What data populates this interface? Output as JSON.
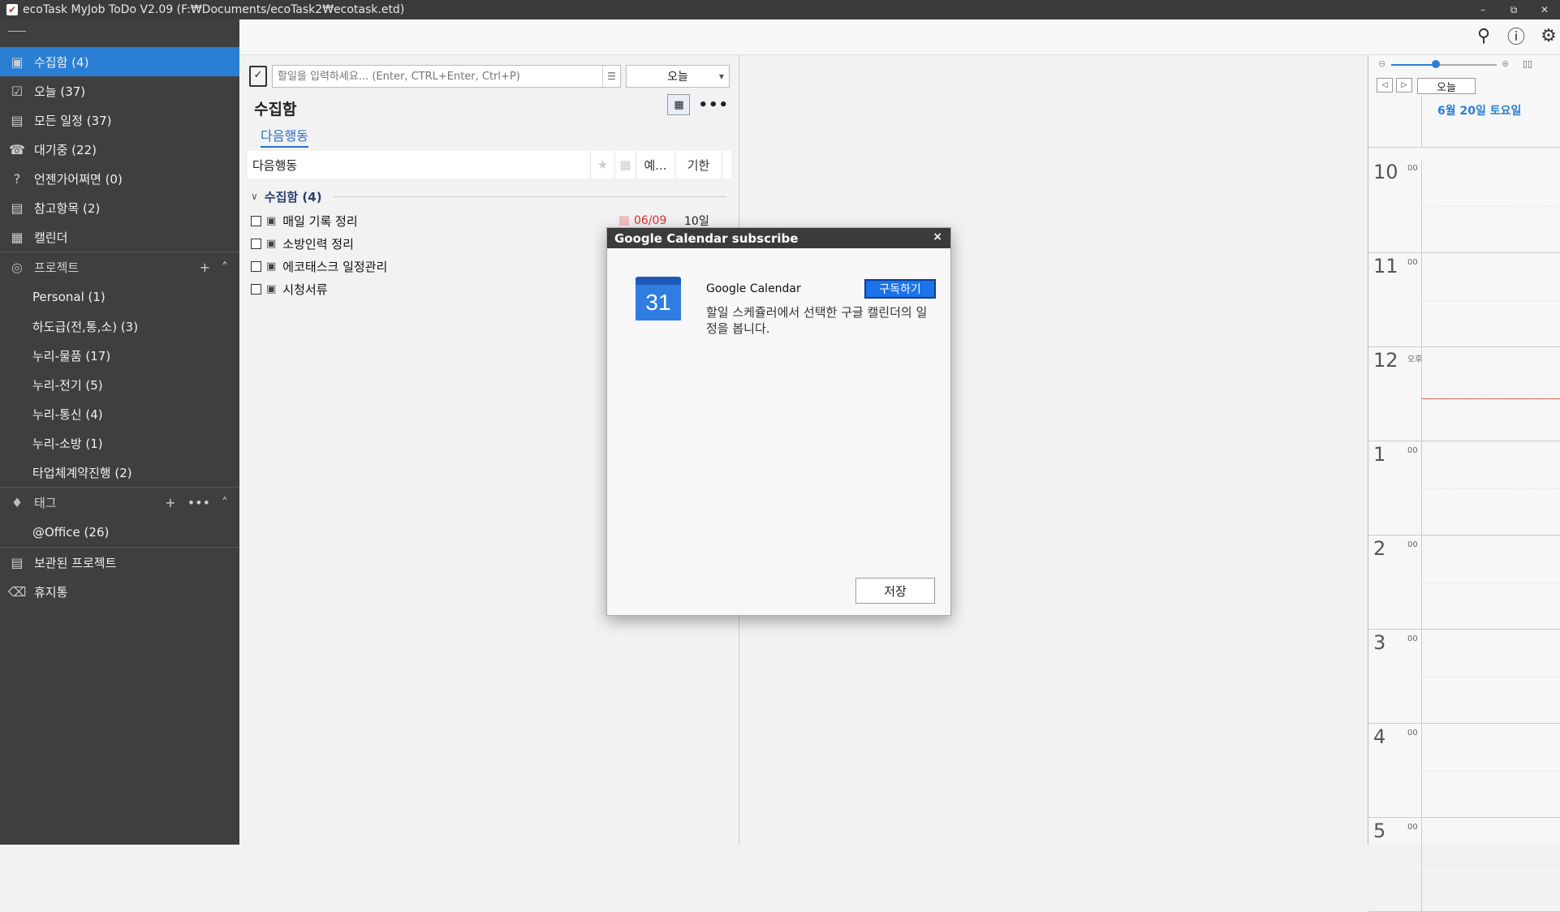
{
  "window": {
    "title": "ecoTask MyJob ToDo V2.09 (F:₩Documents/ecoTask2₩ecotask.etd)",
    "minimize_icon": "minimize-icon",
    "restore_icon": "restore-icon",
    "close_icon": "close-icon"
  },
  "sidebar": {
    "items": [
      {
        "label": "수집함 (4)",
        "icon": "inbox-icon",
        "active": true
      },
      {
        "label": "오늘 (37)",
        "icon": "today-check-icon"
      },
      {
        "label": "모든 일정 (37)",
        "icon": "calendar-icon"
      },
      {
        "label": "대기중 (22)",
        "icon": "phone-icon"
      },
      {
        "label": "언젠가어쩌면 (0)",
        "icon": "question-icon"
      },
      {
        "label": "참고항목 (2)",
        "icon": "document-icon"
      },
      {
        "label": "캘린더",
        "icon": "calendar-grid-icon"
      }
    ],
    "projects_section": {
      "label": "프로젝트",
      "add": "+",
      "collapse": "˄"
    },
    "projects": [
      {
        "label": "Personal (1)"
      },
      {
        "label": "하도급(전,통,소) (3)"
      },
      {
        "label": "누리-물품 (17)"
      },
      {
        "label": "누리-전기 (5)"
      },
      {
        "label": "누리-통신 (4)"
      },
      {
        "label": "누리-소방 (1)"
      },
      {
        "label": "타업체계약진행 (2)"
      }
    ],
    "tags_section": {
      "label": "태그",
      "add": "+",
      "more": "•••",
      "collapse": "˄"
    },
    "tags": [
      {
        "label": "@Office (26)"
      }
    ],
    "bottom": [
      {
        "label": "보관된 프로젝트",
        "icon": "archive-icon"
      },
      {
        "label": "휴지통",
        "icon": "trash-icon"
      }
    ]
  },
  "center": {
    "input_placeholder": "할일을 입력하세요... (Enter, CTRL+Enter, Ctrl+P)",
    "date_select": "오늘",
    "title": "수집함",
    "tab": "다음행동",
    "columns": {
      "name": "다음행동",
      "est": "예...",
      "due": "기한"
    },
    "group": {
      "label": "수집함 (4)"
    },
    "tasks": [
      {
        "title": "매일 기록 정리",
        "due": "06/09",
        "duration": "10일",
        "flagged": true
      },
      {
        "title": "소방인력 정리"
      },
      {
        "title": "에코태스크 일정관리"
      },
      {
        "title": "시청서류"
      }
    ]
  },
  "calendar": {
    "today_button": "오늘",
    "day_header": "6월 20일 토요일",
    "hours": [
      {
        "h": "10",
        "m": "00"
      },
      {
        "h": "11",
        "m": "00"
      },
      {
        "h": "12",
        "m": "오후"
      },
      {
        "h": "1",
        "m": "00"
      },
      {
        "h": "2",
        "m": "00"
      },
      {
        "h": "3",
        "m": "00"
      },
      {
        "h": "4",
        "m": "00"
      },
      {
        "h": "5",
        "m": "00"
      }
    ]
  },
  "dialog": {
    "title": "Google Calendar subscribe",
    "close": "×",
    "calendar_number": "31",
    "service_name": "Google Calendar",
    "subscribe_button": "구독하기",
    "description": "할일 스케쥴러에서 선택한 구글 캘린더의 일정을 봅니다.",
    "save_button": "저장"
  },
  "colors": {
    "accent": "#2a7fd4",
    "sidebar_bg": "#3f3f3f",
    "titlebar_bg": "#3b3b3b",
    "due_red": "#d9302f"
  }
}
